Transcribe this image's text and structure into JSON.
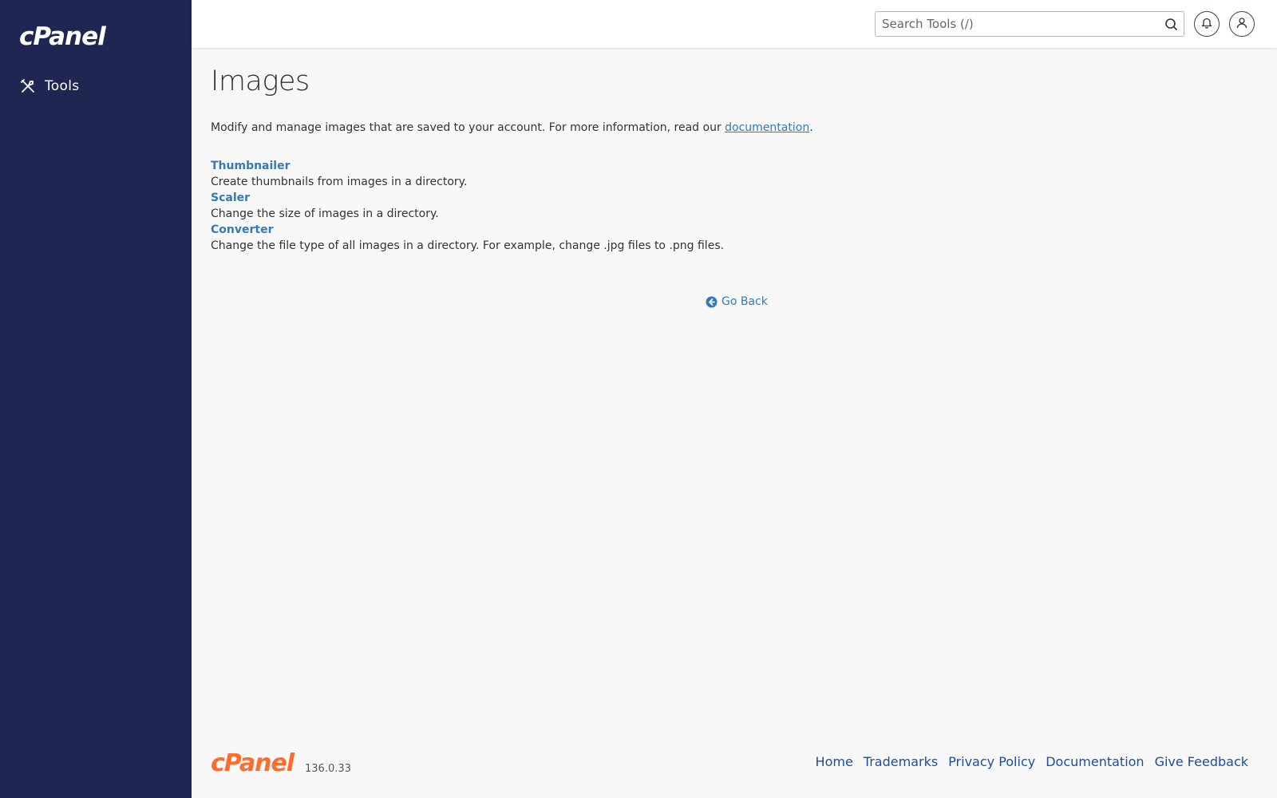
{
  "sidebar": {
    "logo": "cPanel",
    "items": [
      {
        "label": "Tools",
        "icon": "tools-icon"
      }
    ]
  },
  "header": {
    "search_placeholder": "Search Tools (/)",
    "icons": [
      "search-icon",
      "bell-icon",
      "user-icon"
    ]
  },
  "main": {
    "title": "Images",
    "intro_text": "Modify and manage images that are saved to your account. For more information, read our ",
    "intro_link": "documentation",
    "intro_end": ".",
    "tools": [
      {
        "name": "Thumbnailer",
        "description": "Create thumbnails from images in a directory."
      },
      {
        "name": "Scaler",
        "description": "Change the size of images in a directory."
      },
      {
        "name": "Converter",
        "description": "Change the file type of all images in a directory. For example, change .jpg files to .png files."
      }
    ],
    "go_back": "Go Back"
  },
  "footer": {
    "logo": "cPanel",
    "version": "136.0.33",
    "links": [
      "Home",
      "Trademarks",
      "Privacy Policy",
      "Documentation",
      "Give Feedback"
    ]
  },
  "colors": {
    "sidebar_bg": "#1f2651",
    "link": "#337ab7",
    "footer_link": "#1f4b9e",
    "brand_orange": "#ff6c2c"
  }
}
